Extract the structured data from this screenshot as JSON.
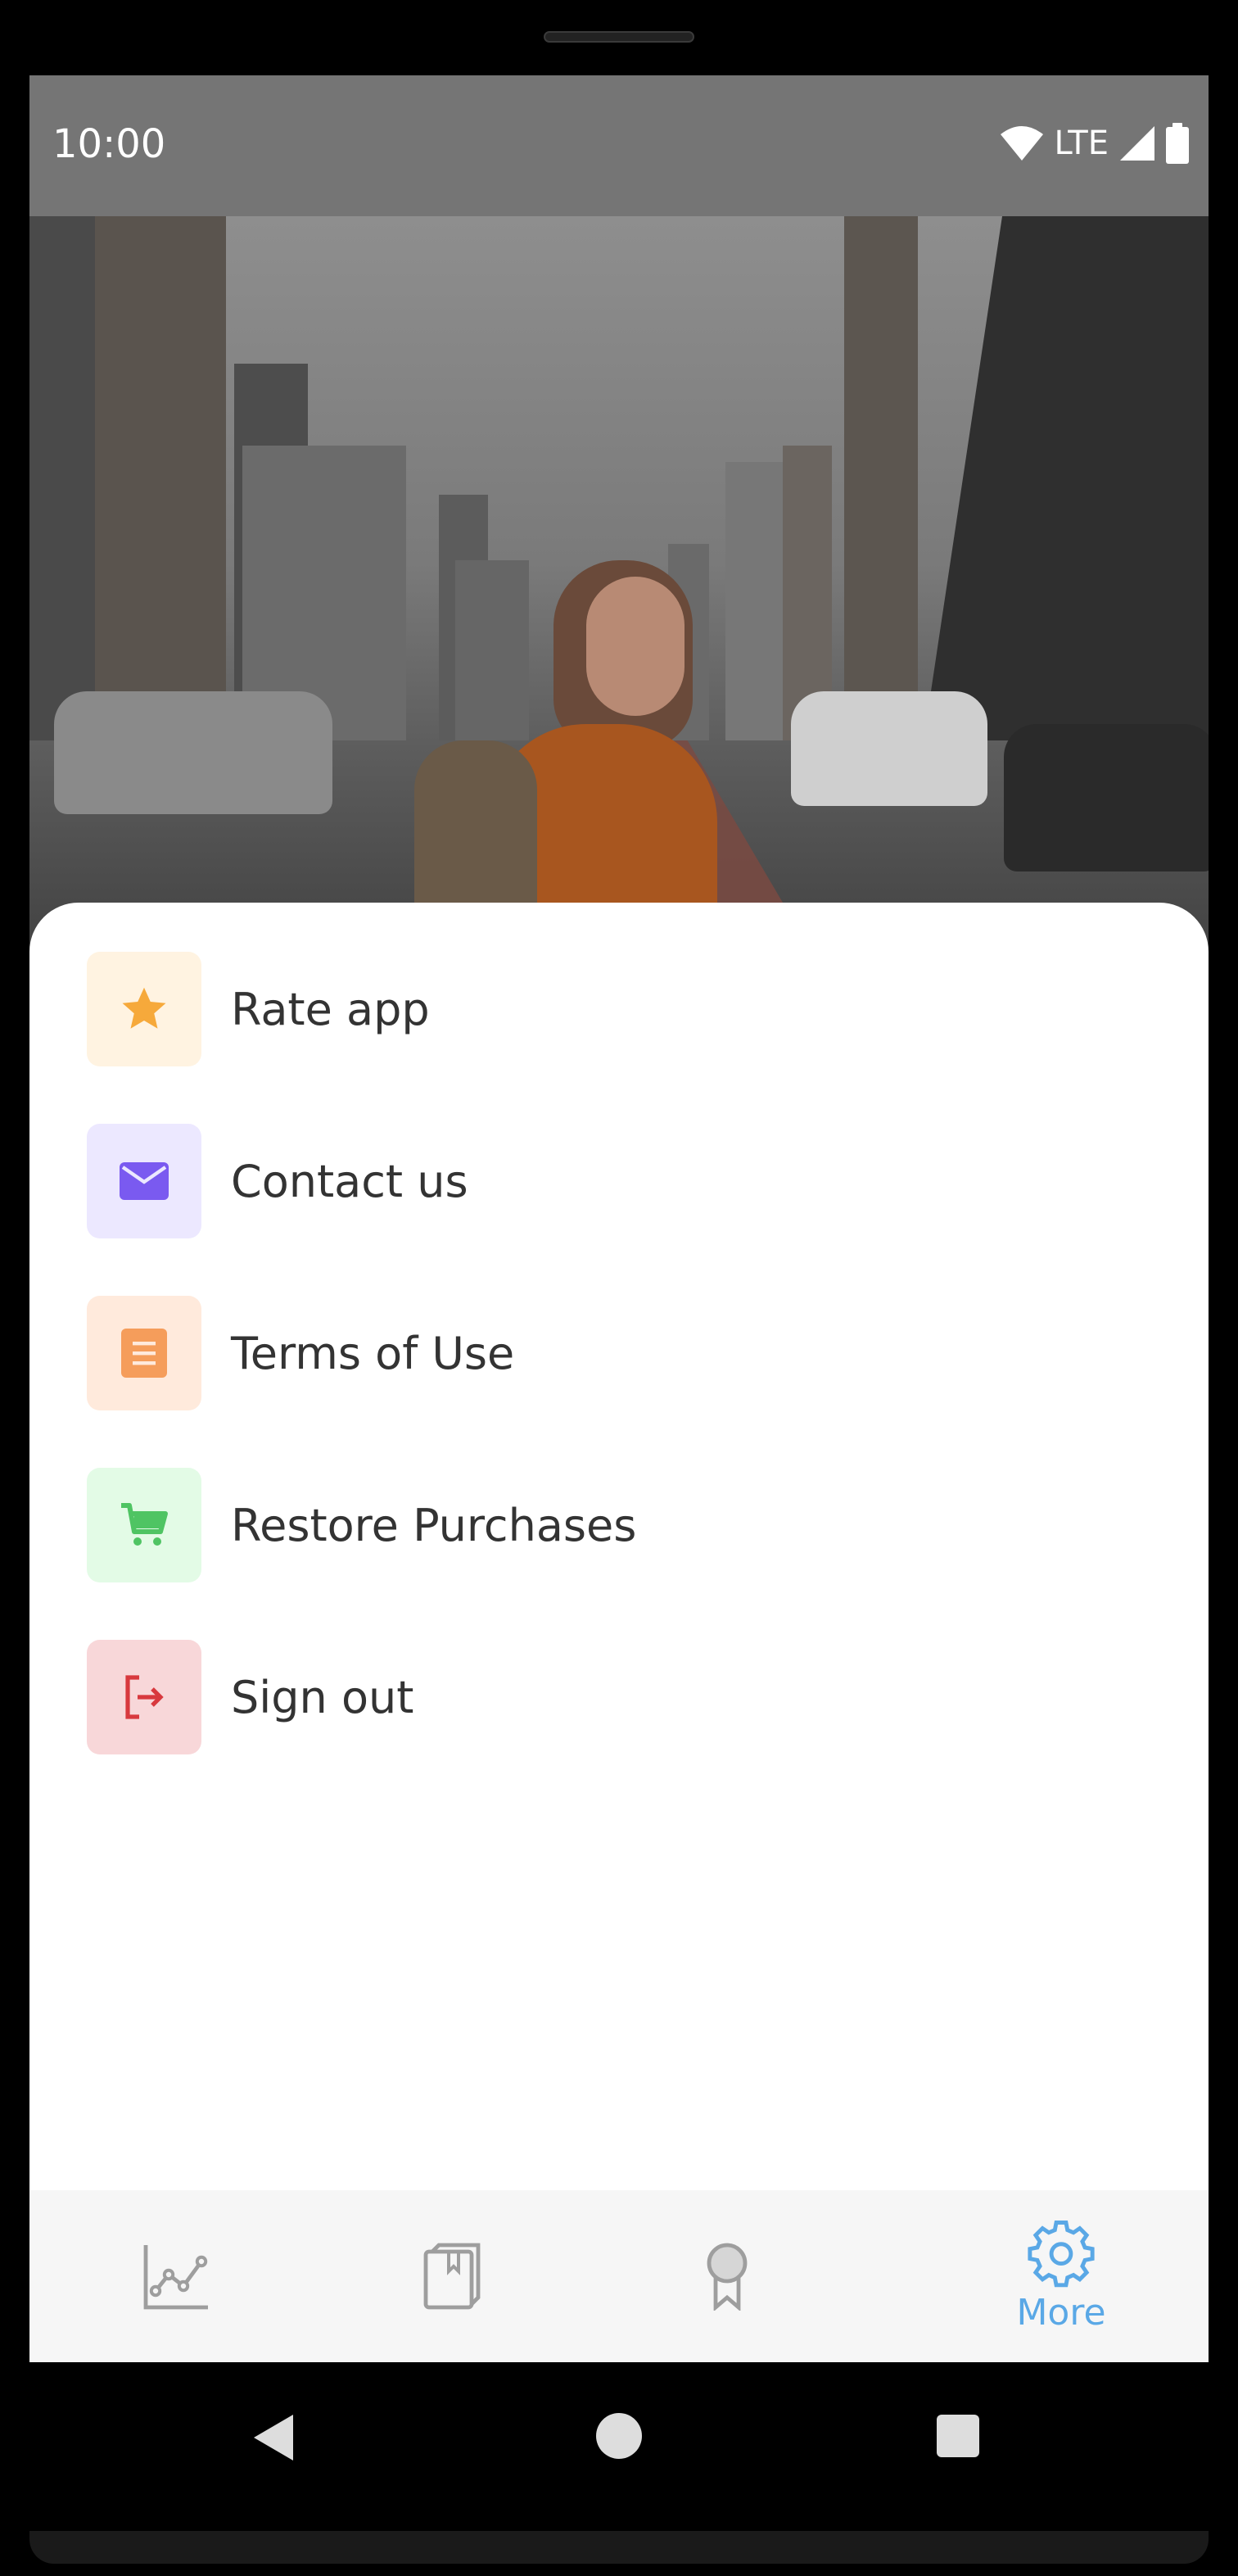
{
  "status_bar": {
    "time": "10:00",
    "network": "LTE",
    "icons": [
      "wifi-icon",
      "cell-signal-icon",
      "battery-icon"
    ]
  },
  "menu": {
    "items": [
      {
        "label": "Rate app",
        "icon": "star-icon",
        "icon_color": "#F6A93B",
        "bg_color": "#FFF3E1"
      },
      {
        "label": "Contact us",
        "icon": "mail-icon",
        "icon_color": "#7A5AF0",
        "bg_color": "#ECE8FF"
      },
      {
        "label": "Terms of Use",
        "icon": "document-icon",
        "icon_color": "#F59D5B",
        "bg_color": "#FFEADC"
      },
      {
        "label": "Restore Purchases",
        "icon": "cart-icon",
        "icon_color": "#4FC463",
        "bg_color": "#E3FBE6"
      },
      {
        "label": "Sign out",
        "icon": "sign-out-icon",
        "icon_color": "#D8393E",
        "bg_color": "#F8D7D9"
      }
    ]
  },
  "bottom_nav": {
    "items": [
      {
        "icon": "chart-icon",
        "label": ""
      },
      {
        "icon": "book-icon",
        "label": ""
      },
      {
        "icon": "award-icon",
        "label": ""
      },
      {
        "icon": "gear-icon",
        "label": "More",
        "active": true
      }
    ],
    "active_color": "#5AA8E6",
    "inactive_color": "#9E9E9E"
  }
}
